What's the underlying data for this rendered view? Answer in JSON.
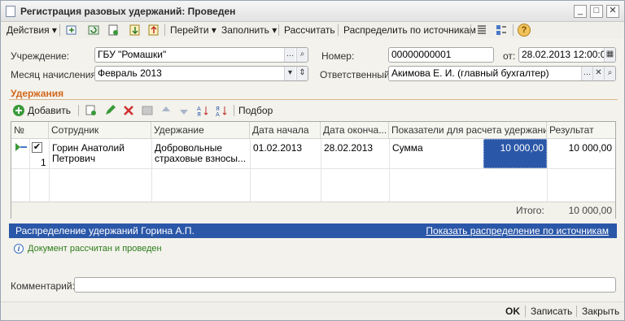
{
  "window": {
    "title": "Регистрация разовых удержаний: Проведен",
    "controls": {
      "minimize": "_",
      "maximize": "□",
      "close": "✕"
    }
  },
  "toolbar": {
    "actions": "Действия",
    "goto": "Перейти",
    "fill": "Заполнить",
    "calculate": "Рассчитать",
    "distribute": "Распределить по источникам",
    "help": "?"
  },
  "header": {
    "institution_label": "Учреждение:",
    "institution_value": "ГБУ \"Ромашки\"",
    "number_label": "Номер:",
    "number_value": "00000000001",
    "date_label": "от:",
    "date_value": "28.02.2013 12:00:00",
    "month_label": "Месяц начисления:",
    "month_value": "Февраль 2013",
    "responsible_label": "Ответственный:",
    "responsible_value": "Акимова Е. И. (главный бухгалтер)"
  },
  "deductions": {
    "section_title": "Удержания",
    "add_label": "Добавить",
    "pick_label": "Подбор",
    "columns": [
      "№",
      "Сотрудник",
      "Удержание",
      "Дата начала",
      "Дата оконча...",
      "Показатели для расчета удержания",
      "Результат"
    ],
    "rows": [
      {
        "num": "1",
        "employee_line1": "Горин Анатолий",
        "employee_line2": "Петрович",
        "deduction_line1": "Добровольные",
        "deduction_line2": "страховые взносы...",
        "start": "01.02.2013",
        "end": "28.02.2013",
        "indicator": "Сумма",
        "indicator_value": "10 000,00",
        "result": "10 000,00"
      }
    ],
    "total_label": "Итого:",
    "total_value": "10 000,00"
  },
  "distribution": {
    "title": "Распределение удержаний Горина А.П.",
    "link": "Показать распределение по источникам"
  },
  "status": {
    "message": "Документ рассчитан и проведен"
  },
  "comment": {
    "label": "Комментарий:",
    "value": ""
  },
  "bottom": {
    "ok": "OK",
    "save": "Записать",
    "close": "Закрыть"
  },
  "colors": {
    "section_title": "#d2671b",
    "selection": "#2b57a8",
    "status_text": "#2d7d1b"
  }
}
